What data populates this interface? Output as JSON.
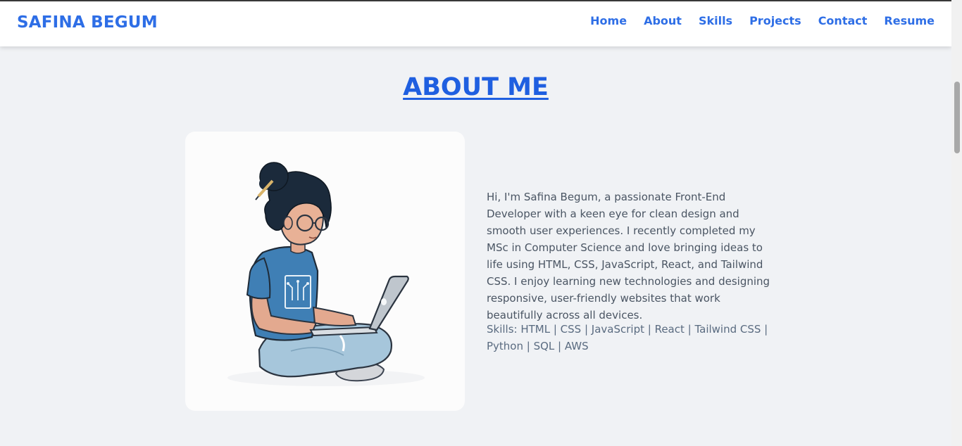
{
  "header": {
    "brand": "SAFINA BEGUM",
    "nav": [
      "Home",
      "About",
      "Skills",
      "Projects",
      "Contact",
      "Resume"
    ]
  },
  "about": {
    "title": "ABOUT ME",
    "bio": "Hi, I'm Safina Begum, a passionate Front-End Developer with a keen eye for clean design and smooth user experiences. I recently completed my MSc in Computer Science and love bringing ideas to life using HTML, CSS, JavaScript, React, and Tailwind CSS. I enjoy learning new technologies and designing responsive, user-friendly websites that work beautifully across all devices.",
    "skills": "Skills: HTML | CSS | JavaScript | React | Tailwind CSS | Python | SQL | AWS"
  },
  "colors": {
    "accent": "#2e6ee6",
    "title": "#1f5fe0",
    "background": "#f0f2f5"
  },
  "icons": {
    "illustration": "girl-with-laptop-illustration"
  }
}
